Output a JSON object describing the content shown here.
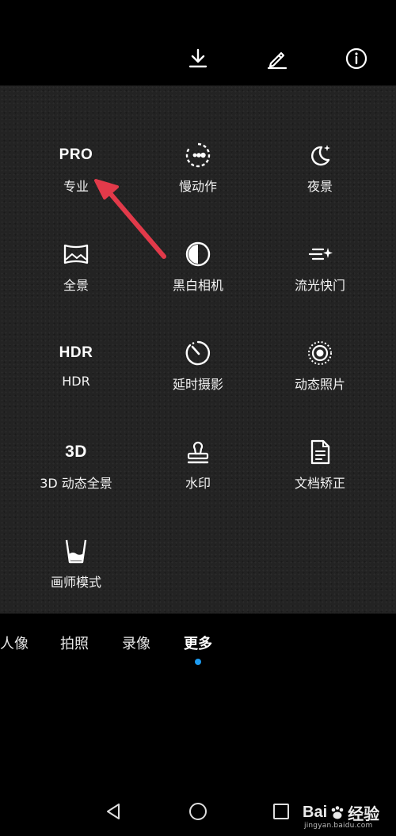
{
  "top_bar": {
    "icons": [
      "download-icon",
      "edit-icon",
      "info-icon"
    ]
  },
  "modes": [
    {
      "label": "专业",
      "icon": "pro-icon",
      "icon_text": "PRO"
    },
    {
      "label": "慢动作",
      "icon": "slow-motion-icon"
    },
    {
      "label": "夜景",
      "icon": "night-icon"
    },
    {
      "label": "全景",
      "icon": "panorama-icon"
    },
    {
      "label": "黑白相机",
      "icon": "monochrome-icon"
    },
    {
      "label": "流光快门",
      "icon": "light-painting-icon"
    },
    {
      "label": "HDR",
      "icon": "hdr-icon",
      "icon_text": "HDR"
    },
    {
      "label": "延时摄影",
      "icon": "time-lapse-icon"
    },
    {
      "label": "动态照片",
      "icon": "moving-picture-icon"
    },
    {
      "label": "3D 动态全景",
      "icon": "3d-panorama-icon",
      "icon_text": "3D"
    },
    {
      "label": "水印",
      "icon": "watermark-stamp-icon"
    },
    {
      "label": "文档矫正",
      "icon": "document-icon"
    },
    {
      "label": "画师模式",
      "icon": "artist-cup-icon"
    }
  ],
  "tabs": [
    {
      "label": "人像",
      "active": false
    },
    {
      "label": "拍照",
      "active": false
    },
    {
      "label": "录像",
      "active": false
    },
    {
      "label": "更多",
      "active": true
    }
  ],
  "nav_bar": {
    "icons": [
      "back-icon",
      "home-icon",
      "recents-icon"
    ]
  },
  "watermark": {
    "brand_left": "Bai",
    "brand_right": "经验",
    "url": "jingyan.baidu.com"
  },
  "colors": {
    "panel_bg": "#232323",
    "active_dot": "#1d9bf0",
    "annotation_arrow": "#e23a4a"
  }
}
